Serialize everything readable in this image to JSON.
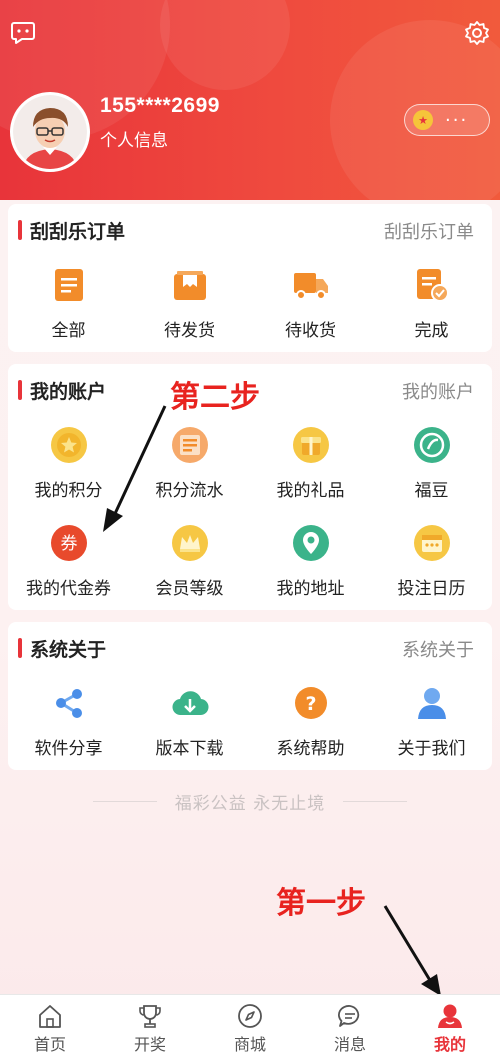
{
  "colors": {
    "brand": "#e8343a",
    "annotation": "#e8231f"
  },
  "header": {
    "phone": "155****2699",
    "profile_label": "个人信息",
    "points_more": "···",
    "chat_icon": "chat-icon",
    "settings_icon": "gear-icon"
  },
  "sections": [
    {
      "title": "刮刮乐订单",
      "link": "刮刮乐订单",
      "items": [
        {
          "label": "全部",
          "icon": "document-icon"
        },
        {
          "label": "待发货",
          "icon": "package-icon"
        },
        {
          "label": "待收货",
          "icon": "truck-icon"
        },
        {
          "label": "完成",
          "icon": "done-doc-icon"
        }
      ]
    },
    {
      "title": "我的账户",
      "link": "我的账户",
      "items": [
        {
          "label": "我的积分",
          "icon": "points-coin-icon"
        },
        {
          "label": "积分流水",
          "icon": "points-record-icon"
        },
        {
          "label": "我的礼品",
          "icon": "gift-icon"
        },
        {
          "label": "福豆",
          "icon": "bean-icon"
        },
        {
          "label": "我的代金券",
          "icon": "voucher-icon",
          "badge": "券"
        },
        {
          "label": "会员等级",
          "icon": "crown-icon"
        },
        {
          "label": "我的地址",
          "icon": "location-icon"
        },
        {
          "label": "投注日历",
          "icon": "calendar-icon"
        }
      ]
    },
    {
      "title": "系统关于",
      "link": "系统关于",
      "items": [
        {
          "label": "软件分享",
          "icon": "share-icon"
        },
        {
          "label": "版本下载",
          "icon": "cloud-download-icon"
        },
        {
          "label": "系统帮助",
          "icon": "help-icon",
          "badge": "?"
        },
        {
          "label": "关于我们",
          "icon": "person-icon"
        }
      ]
    }
  ],
  "slogan": "福彩公益 永无止境",
  "annotations": {
    "step1": "第一步",
    "step2": "第二步"
  },
  "tabs": [
    {
      "label": "首页",
      "icon": "home-icon"
    },
    {
      "label": "开奖",
      "icon": "trophy-icon"
    },
    {
      "label": "商城",
      "icon": "compass-icon"
    },
    {
      "label": "消息",
      "icon": "message-icon"
    },
    {
      "label": "我的",
      "icon": "profile-icon",
      "active": true
    }
  ]
}
